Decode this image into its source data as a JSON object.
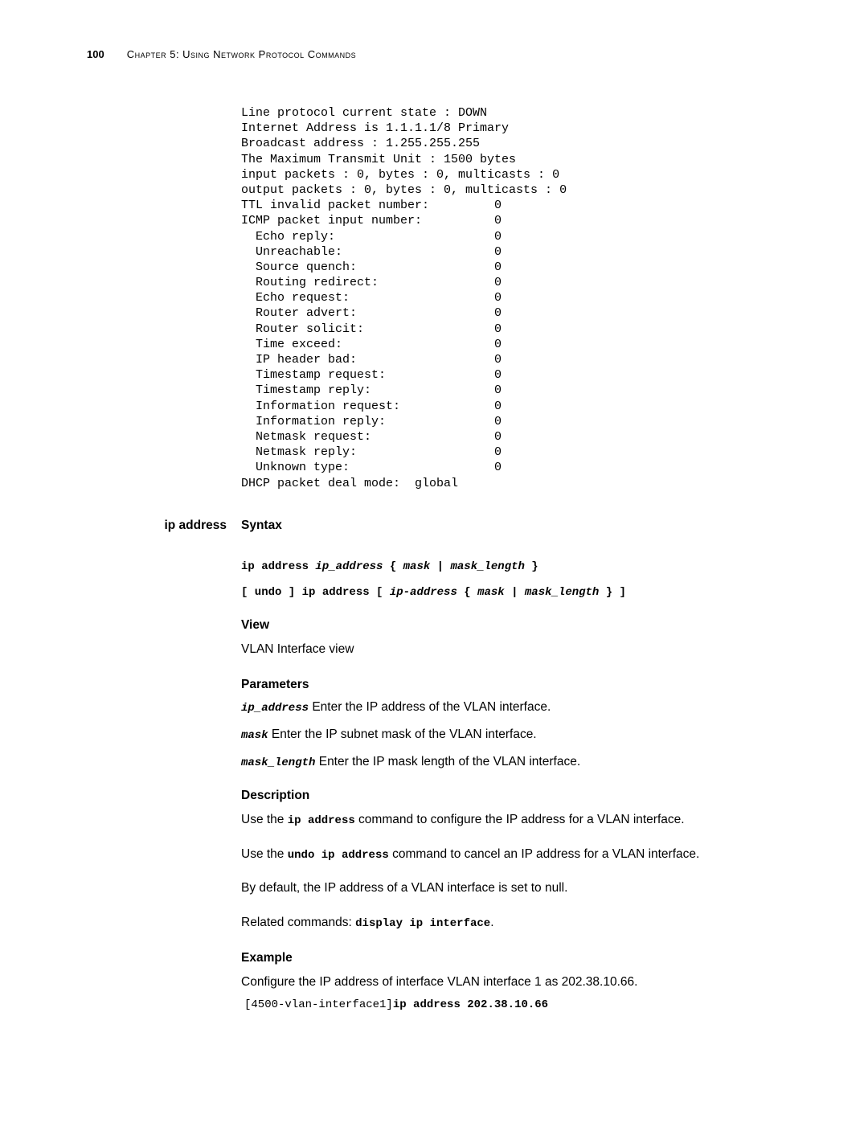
{
  "header": {
    "page_number": "100",
    "chapter": "Chapter 5: Using Network Protocol Commands"
  },
  "code_output": "Line protocol current state : DOWN\nInternet Address is 1.1.1.1/8 Primary\nBroadcast address : 1.255.255.255\nThe Maximum Transmit Unit : 1500 bytes\ninput packets : 0, bytes : 0, multicasts : 0\noutput packets : 0, bytes : 0, multicasts : 0\nTTL invalid packet number:         0\nICMP packet input number:          0\n  Echo reply:                      0\n  Unreachable:                     0\n  Source quench:                   0\n  Routing redirect:                0\n  Echo request:                    0\n  Router advert:                   0\n  Router solicit:                  0\n  Time exceed:                     0\n  IP header bad:                   0\n  Timestamp request:               0\n  Timestamp reply:                 0\n  Information request:             0\n  Information reply:               0\n  Netmask request:                 0\n  Netmask reply:                   0\n  Unknown type:                    0\nDHCP packet deal mode:  global",
  "command_name": "ip address",
  "syntax": {
    "heading": "Syntax",
    "line1_cmd": "ip address ",
    "line1_arg1": "ip_address",
    "line1_mid1": " { ",
    "line1_arg2": "mask",
    "line1_mid2": " | ",
    "line1_arg3": "mask_length",
    "line1_end": " }",
    "line2_start": "[ undo ] ip address [ ",
    "line2_arg1": "ip-address",
    "line2_mid1": " { ",
    "line2_arg2": "mask",
    "line2_mid2": " | ",
    "line2_arg3": "mask_length",
    "line2_end": " } ]"
  },
  "view": {
    "heading": "View",
    "text": "VLAN Interface view"
  },
  "parameters": {
    "heading": "Parameters",
    "items": [
      {
        "name": "ip_address",
        "desc": "  Enter the IP address of the VLAN interface."
      },
      {
        "name": "mask",
        "desc": "  Enter the IP subnet mask of the VLAN interface."
      },
      {
        "name": "mask_length",
        "desc": " Enter the IP mask length of the VLAN interface."
      }
    ]
  },
  "description": {
    "heading": "Description",
    "p1_a": "Use the ",
    "p1_code": "ip address",
    "p1_b": " command to configure the IP address for a VLAN interface.",
    "p2_a": "Use the ",
    "p2_code": "undo ip address",
    "p2_b": " command to cancel an IP address for a VLAN interface.",
    "p3": "By default, the IP address of a VLAN interface is set to null.",
    "p4_a": "Related commands: ",
    "p4_code": "display ip interface",
    "p4_b": "."
  },
  "example": {
    "heading": "Example",
    "text": "Configure the IP address of interface VLAN interface 1 as 202.38.10.66.",
    "prompt": "[4500-vlan-interface1]",
    "cmd": "ip address 202.38.10.66"
  }
}
